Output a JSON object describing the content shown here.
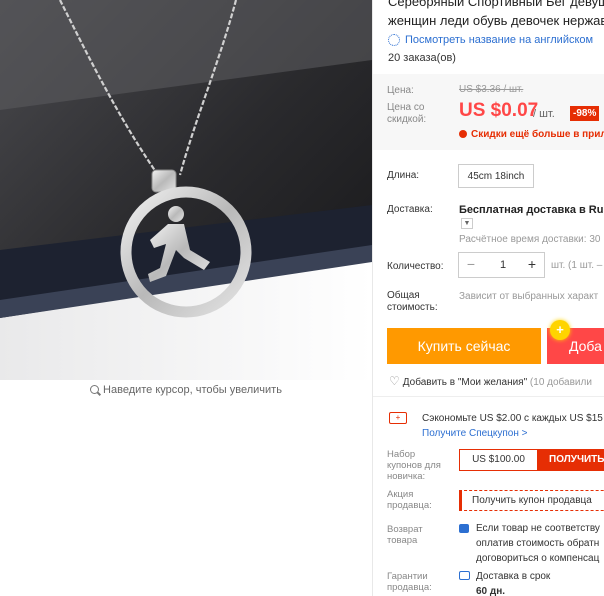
{
  "product": {
    "title_lines": [
      "Серебряный Спортивный Бег девуш",
      "женщин леди обувь девочек нержав"
    ],
    "translate_link": "Посмотреть название на английском",
    "orders": "20 заказа(ов)"
  },
  "image": {
    "zoom_hint": "Наведите курсор, чтобы увеличить"
  },
  "price": {
    "label": "Цена:",
    "old_value": "US $3.36 / шт.",
    "discount_label": "Цена со скидкой:",
    "new_value": "US $0.07",
    "per_unit": "/ шт.",
    "discount_badge": "-98%",
    "promo_text": "Скидки ещё больше в прил"
  },
  "length": {
    "label": "Длина:",
    "option": "45cm 18inch"
  },
  "shipping": {
    "label": "Доставка:",
    "value": "Бесплатная доставка в Russi",
    "estimated": "Расчётное время доставки: 30"
  },
  "quantity": {
    "label": "Количество:",
    "minus": "−",
    "value": "1",
    "plus": "+",
    "note": "шт. (1 шт. –"
  },
  "total": {
    "label": "Общая стоимость:",
    "value": "Зависит от выбранных характ"
  },
  "actions": {
    "buy_now": "Купить сейчас",
    "add_to_cart": "Доба",
    "add_plus": "+"
  },
  "wishlist": {
    "text": "Добавить в \"Мои желания\"",
    "count": "(10 добавили"
  },
  "coupons": {
    "save_text": "Сэкономьте US $2.00 с каждых US $15",
    "spec_coupon_link": "Получите Спецкупон >",
    "newbie_label": "Набор купонов для новичка:",
    "newbie_amount": "US $100.00",
    "newbie_get": "ПОЛУЧИТЬ",
    "seller_label": "Акция продавца:",
    "seller_coupon": "Получить купон продавца"
  },
  "return": {
    "label": "Возврат товара",
    "lines": [
      "Если товар не соответству",
      "оплатив стоимость обратн",
      "договориться о компенсац"
    ]
  },
  "guarantee": {
    "label": "Гарантии продавца:",
    "line1": "Доставка в срок",
    "line2": "60 дн."
  }
}
